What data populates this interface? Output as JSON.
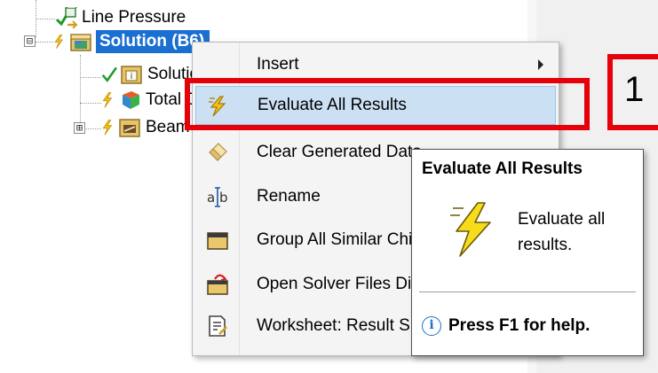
{
  "tree": {
    "items": [
      {
        "label": "Line Pressure",
        "icon": "line-pressure-icon",
        "status": "check"
      },
      {
        "label": "Solution (B6)",
        "icon": "solution-icon",
        "status": "lightning",
        "selected": true,
        "expander": "⊟"
      },
      {
        "label": "Solution Information",
        "icon": "solution-information-icon",
        "status": "check"
      },
      {
        "label": "Total Deformation",
        "icon": "total-deformation-icon",
        "status": "lightning"
      },
      {
        "label": "Beam Tool",
        "icon": "beam-tool-icon",
        "status": "lightning",
        "expander": "⊞"
      }
    ]
  },
  "context_menu": {
    "items": [
      {
        "label": "Insert",
        "icon": "",
        "submenu": true
      },
      {
        "label": "Evaluate All Results",
        "icon": "evaluate-lightning-icon",
        "highlighted": true
      },
      {
        "label": "Clear Generated Data",
        "icon": "eraser-icon"
      },
      {
        "label": "Rename",
        "icon": "rename-icon"
      },
      {
        "label": "Group All Similar Children",
        "icon": "folder-icon"
      },
      {
        "label": "Open Solver Files Directory",
        "icon": "open-folder-icon"
      },
      {
        "label": "Worksheet: Result Summary",
        "icon": "worksheet-icon"
      }
    ]
  },
  "tooltip": {
    "title": "Evaluate All Results",
    "body": "Evaluate all results.",
    "help": "Press F1 for help."
  },
  "annotation": {
    "step_label": "1",
    "color": "#e5000a"
  },
  "colors": {
    "selection": "#1a6fd1",
    "menu_highlight": "#cce0f4",
    "lightning": "#f2c318"
  }
}
